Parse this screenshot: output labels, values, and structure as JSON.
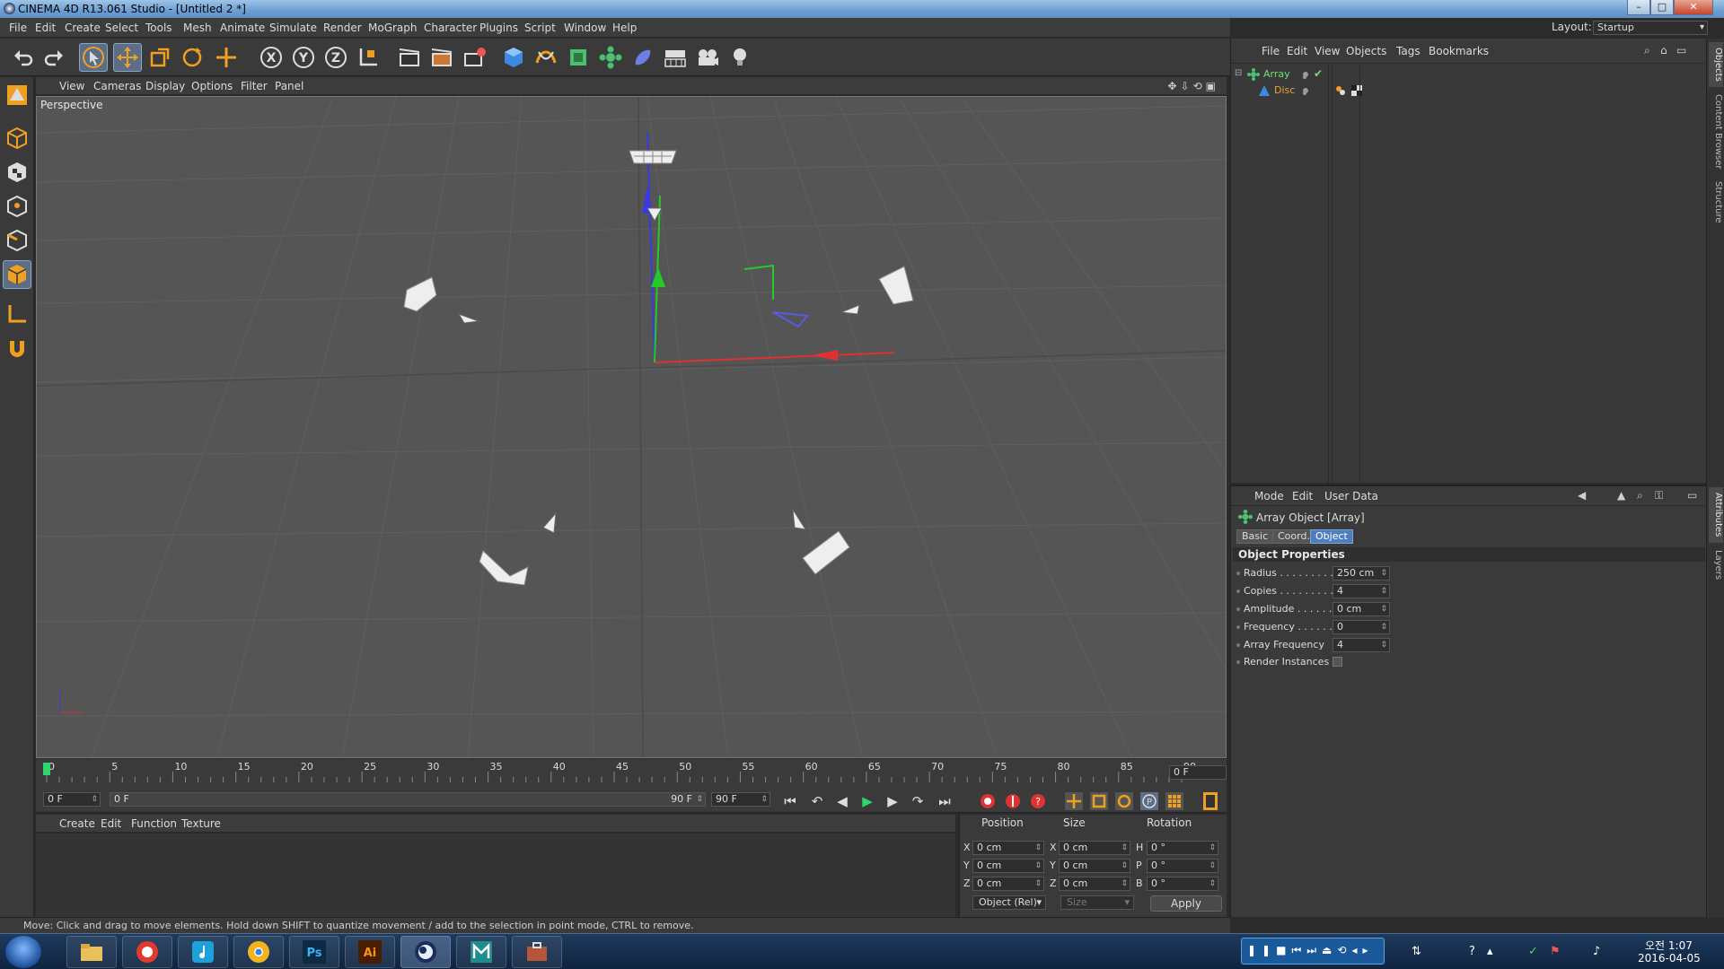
{
  "window": {
    "title": "CINEMA 4D R13.061 Studio - [Untitled 2 *]",
    "buttons": {
      "minimize": "–",
      "maximize": "□",
      "close": "✕"
    }
  },
  "menubar": [
    "File",
    "Edit",
    "Create",
    "Select",
    "Tools",
    "Mesh",
    "Animate",
    "Simulate",
    "Render",
    "MoGraph",
    "Character",
    "Plugins",
    "Script",
    "Window",
    "Help"
  ],
  "layout": {
    "label": "Layout:",
    "value": "Startup"
  },
  "toolbar": {
    "icons": [
      "undo-icon",
      "redo-icon",
      "select-icon",
      "move-icon",
      "scale-icon",
      "rotate-icon",
      "recent-tool-icon",
      "x-axis-icon",
      "y-axis-icon",
      "z-axis-icon",
      "coordinate-system-icon",
      "render-view-icon",
      "render-picture-viewer-icon",
      "edit-render-settings-icon",
      "cube-icon",
      "spline-icon",
      "nurbs-icon",
      "array-icon",
      "deformer-icon",
      "scene-floor-icon",
      "camera-icon",
      "light-icon"
    ],
    "axis_labels": [
      "X",
      "Y",
      "Z"
    ],
    "active": [
      "select",
      "move"
    ]
  },
  "left_tools": [
    "make-editable-icon",
    "model-mode-icon",
    "texture-mode-icon",
    "points-mode-icon",
    "edges-mode-icon",
    "polygons-mode-icon",
    "workplane-icon",
    "snap-icon"
  ],
  "viewport": {
    "menu": [
      "View",
      "Cameras",
      "Display",
      "Options",
      "Filter",
      "Panel"
    ],
    "label": "Perspective",
    "nav_icons": "✥⇩⟲▣",
    "bg_color": "#555555"
  },
  "timeline": {
    "ticks": [
      "0",
      "5",
      "10",
      "15",
      "20",
      "25",
      "30",
      "35",
      "40",
      "45",
      "50",
      "55",
      "60",
      "65",
      "70",
      "75",
      "80",
      "85",
      "90"
    ],
    "current_frame": "0 F"
  },
  "transport": {
    "start_field": "0 F",
    "range_start": "0 F",
    "range_end": "90 F",
    "end_field": "90 F",
    "buttons": [
      "⏮",
      "↶",
      "◀",
      "▶",
      "▶",
      "↷",
      "⏭"
    ]
  },
  "material_manager": {
    "menu": [
      "Create",
      "Edit",
      "Function",
      "Texture"
    ]
  },
  "coordinates": {
    "headers": [
      "Position",
      "Size",
      "Rotation"
    ],
    "rows": [
      {
        "axis": "X",
        "pos": "0 cm",
        "saxis": "X",
        "size": "0 cm",
        "raxis": "H",
        "rot": "0 °"
      },
      {
        "axis": "Y",
        "pos": "0 cm",
        "saxis": "Y",
        "size": "0 cm",
        "raxis": "P",
        "rot": "0 °"
      },
      {
        "axis": "Z",
        "pos": "0 cm",
        "saxis": "Z",
        "size": "0 cm",
        "raxis": "B",
        "rot": "0 °"
      }
    ],
    "mode_select": "Object (Rel)",
    "size_select": "Size",
    "apply": "Apply"
  },
  "status": "Move: Click and drag to move elements. Hold down SHIFT to quantize movement / add to the selection in point mode, CTRL to remove.",
  "object_manager": {
    "menu": [
      "File",
      "Edit",
      "View",
      "Objects",
      "Tags",
      "Bookmarks"
    ],
    "objects": [
      {
        "name": "Array",
        "color": "#6fe06f"
      },
      {
        "name": "Disc",
        "color": "#e9a13a"
      }
    ]
  },
  "side_tabs_top": [
    "Objects",
    "Content Browser",
    "Structure"
  ],
  "side_tabs_bottom": [
    "Attributes",
    "Layers"
  ],
  "attribute_manager": {
    "menu": [
      "Mode",
      "Edit",
      "User Data"
    ],
    "title": "Array Object [Array]",
    "tabs": [
      "Basic",
      "Coord.",
      "Object"
    ],
    "section": "Object Properties",
    "properties": [
      {
        "label": "Radius . . . . . . . . . .",
        "value": "250 cm"
      },
      {
        "label": "Copies . . . . . . . . . .",
        "value": "4"
      },
      {
        "label": "Amplitude . . . . . . .",
        "value": "0 cm"
      },
      {
        "label": "Frequency . . . . . . .",
        "value": "0"
      },
      {
        "label": "Array Frequency",
        "value": "4"
      }
    ],
    "render_instances_label": "Render Instances"
  },
  "taskbar": {
    "apps": [
      "explorer-icon",
      "app-red-icon",
      "music-icon",
      "chrome-icon",
      "photoshop-icon",
      "illustrator-icon",
      "cinema4d-icon",
      "maya-icon",
      "toolbox-icon"
    ],
    "ps_label": "Ps",
    "ai_label": "Ai",
    "clock_time": "오전 1:07",
    "clock_date": "2016-04-05"
  }
}
